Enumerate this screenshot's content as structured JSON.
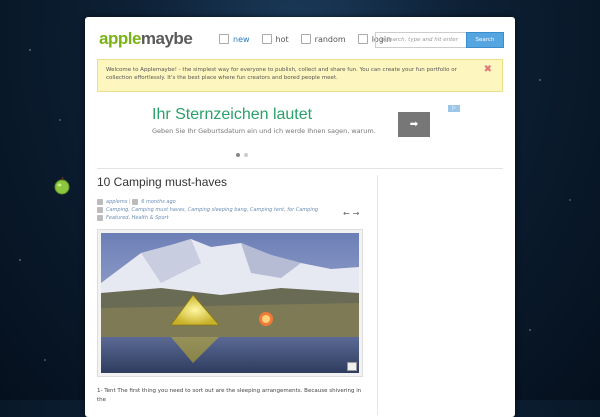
{
  "logo": {
    "part1": "apple",
    "part2": "maybe"
  },
  "nav": [
    {
      "label": "new",
      "icon": "document-icon"
    },
    {
      "label": "hot",
      "icon": "flame-icon"
    },
    {
      "label": "random",
      "icon": "shuffle-icon"
    },
    {
      "label": "login",
      "icon": "pencil-icon"
    }
  ],
  "search": {
    "placeholder": "to search, type and hit enter",
    "button": "Search"
  },
  "notice": {
    "text": "Welcome to Applemaybe! - the simplest way for everyone to publish, collect and share fun. You can create your fun portfolio or collection effortlessly. It's the best place where fun creators and bored people meet.",
    "close": "✖"
  },
  "ad": {
    "title": "Ihr Sternzeichen lautet",
    "subtitle": "Geben Sie Ihr Geburtsdatum ein und ich werde Ihnen sagen, warum.",
    "button": "➡"
  },
  "post": {
    "title": "10 Camping must-haves",
    "author": "applems",
    "date": "6 months ago",
    "tags": "Camping, Camping must haves, Camping sleeping bang, Camping tent, for Camping",
    "categories": "Featured, Health & Sport",
    "prev": "←",
    "next": "→",
    "body": "1- Tent The first thing you need to sort out are the sleeping arrangements. Because shivering in the"
  },
  "colors": {
    "accent": "#7ab317",
    "link": "#2a7bc0",
    "notice_bg": "#fdf6bf"
  }
}
